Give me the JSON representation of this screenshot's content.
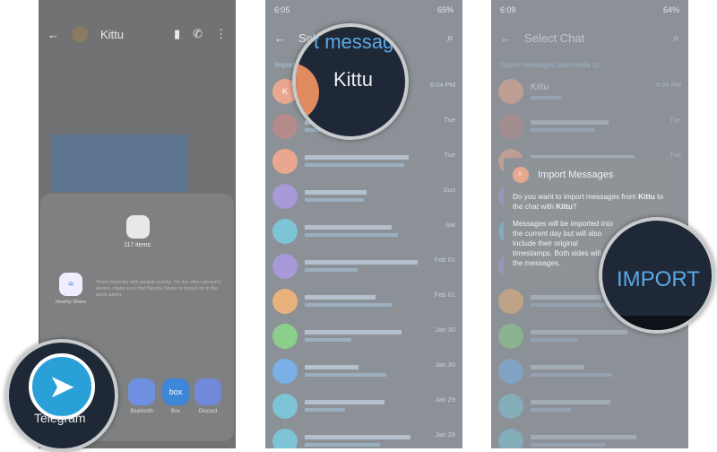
{
  "panel1": {
    "chat_title": "Kittu",
    "share": {
      "items_count": "117 items",
      "nearby_label": "Nearby Share",
      "nearby_desc": "Share instantly with people nearby. On the other person's device, make sure that Nearby Share is turned on in the quick panel.",
      "apps": [
        {
          "label": "Telegram",
          "color": "#2aa0d9"
        },
        {
          "label": "Bluetooth",
          "color": "#6f8fe0"
        },
        {
          "label": "Box",
          "color": "#3d86d8"
        },
        {
          "label": "Discord",
          "color": "#7289da"
        }
      ]
    },
    "magnified_label": "Telegram"
  },
  "panel2": {
    "status": {
      "time": "6:05",
      "battery": "65%"
    },
    "title": "Select Chat",
    "magnified_title": "t messag",
    "subheader": "Import",
    "magnified_name": "Kittu",
    "rows": [
      {
        "name": "",
        "initial": "K",
        "date": "6:04 PM",
        "color": "#e9a78f"
      },
      {
        "name": "",
        "initial": "",
        "date": "Tue",
        "color": "#b58a8a"
      },
      {
        "name": "",
        "initial": "",
        "date": "Tue",
        "color": "#e9a78f",
        "check": true
      },
      {
        "name": "",
        "initial": "",
        "date": "Sun",
        "color": "#a89ad8"
      },
      {
        "name": "",
        "initial": "",
        "date": "Sat",
        "color": "#7cc4d6"
      },
      {
        "name": "",
        "initial": "",
        "date": "Feb 01",
        "color": "#a89ad8"
      },
      {
        "name": "",
        "initial": "",
        "date": "Feb 01",
        "color": "#e9b27c"
      },
      {
        "name": "",
        "initial": "",
        "date": "Jan 30",
        "color": "#8ccf8c",
        "check": true
      },
      {
        "name": "",
        "initial": "",
        "date": "Jan 30",
        "color": "#7ab0e6"
      },
      {
        "name": "",
        "initial": "",
        "date": "Jan 29",
        "color": "#7cc4d6"
      },
      {
        "name": "",
        "initial": "",
        "date": "Jan 28",
        "color": "#7cc4d6"
      }
    ]
  },
  "panel3": {
    "status": {
      "time": "6:09",
      "battery": "64%"
    },
    "title": "Select Chat",
    "subheader": "Import messages and media to...",
    "first_chat": {
      "name": "Kittu",
      "date": "6:08 PM"
    },
    "dialog": {
      "title": "Import Messages",
      "avatar": "K",
      "q_pre": "Do you want to import messages from ",
      "q_name1": "Kittu",
      "q_mid": " to the chat with ",
      "q_name2": "Kittu",
      "q_end": "?",
      "body": "Messages will be imported into the current day but will also include their original timestamps. Both sides will see the messages."
    },
    "import_button": "IMPORT",
    "rows": [
      {
        "date": "6:08 PM",
        "color": "#e9a78f"
      },
      {
        "date": "Tue",
        "color": "#b58a8a"
      },
      {
        "date": "Tue",
        "color": "#e9a78f"
      },
      {
        "date": "",
        "color": "#a89ad8"
      },
      {
        "date": "",
        "color": "#7cc4d6"
      },
      {
        "date": "",
        "color": "#a89ad8"
      },
      {
        "date": "",
        "color": "#e9b27c"
      },
      {
        "date": "",
        "color": "#8ccf8c"
      },
      {
        "date": "",
        "color": "#7ab0e6"
      },
      {
        "date": "",
        "color": "#7cc4d6"
      },
      {
        "date": "",
        "color": "#7cc4d6"
      }
    ]
  }
}
